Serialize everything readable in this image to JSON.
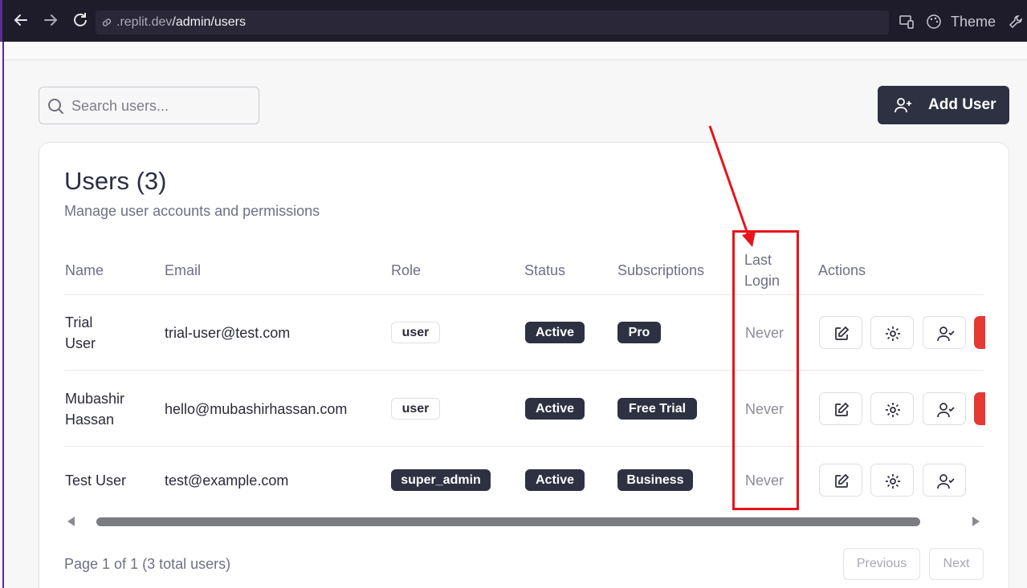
{
  "browser": {
    "url_prefix": ".replit.dev",
    "url_path": "/admin/users",
    "theme_label": "Theme"
  },
  "search": {
    "placeholder": "Search users..."
  },
  "add_user_label": "Add User",
  "card": {
    "title": "Users (3)",
    "subtitle": "Manage user accounts and permissions"
  },
  "table": {
    "headers": {
      "name": "Name",
      "email": "Email",
      "role": "Role",
      "status": "Status",
      "subscriptions": "Subscriptions",
      "last_login_1": "Last",
      "last_login_2": "Login",
      "actions": "Actions"
    },
    "rows": [
      {
        "name_1": "Trial",
        "name_2": "User",
        "email": "trial-user@test.com",
        "role": "user",
        "status": "Active",
        "subscription": "Pro",
        "last_login": "Never"
      },
      {
        "name_1": "Mubashir",
        "name_2": "Hassan",
        "email": "hello@mubashirhassan.com",
        "role": "user",
        "status": "Active",
        "subscription": "Free Trial",
        "last_login": "Never"
      },
      {
        "name_1": "Test User",
        "name_2": "",
        "email": "test@example.com",
        "role": "super_admin",
        "status": "Active",
        "subscription": "Business",
        "last_login": "Never"
      }
    ]
  },
  "pagination": {
    "info": "Page 1 of 1 (3 total users)",
    "previous": "Previous",
    "next": "Next"
  },
  "icons": [
    "back-arrow-icon",
    "forward-arrow-icon",
    "reload-icon",
    "link-icon",
    "devices-icon",
    "palette-icon",
    "wrench-icon",
    "search-icon",
    "user-plus-icon",
    "edit-icon",
    "gear-icon",
    "user-check-icon"
  ],
  "colors": {
    "annotation": "#e8141a",
    "badge_dark": "#2e3142",
    "delete": "#e53935",
    "chrome": "#1e1c2b"
  }
}
